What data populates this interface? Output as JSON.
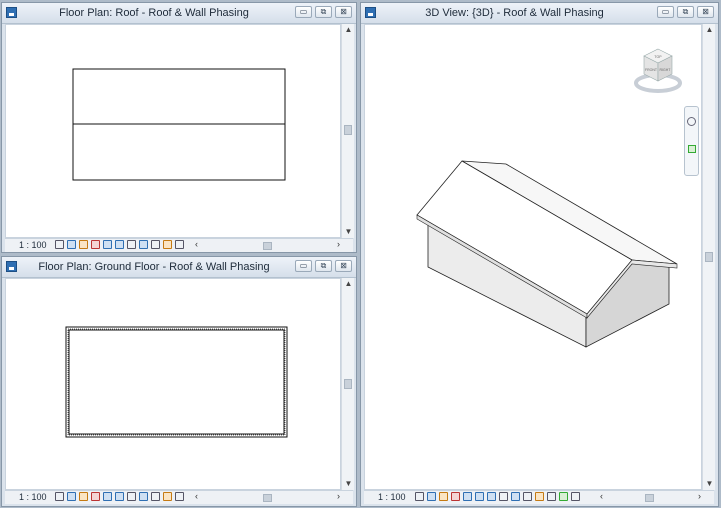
{
  "windows": {
    "roof_plan": {
      "title": "Floor Plan: Roof - Roof & Wall Phasing",
      "scale": "1 : 100"
    },
    "ground_plan": {
      "title": "Floor Plan: Ground Floor - Roof & Wall Phasing",
      "scale": "1 : 100"
    },
    "view3d": {
      "title": "3D View: {3D} - Roof & Wall Phasing",
      "scale": "1 : 100"
    }
  },
  "viewcube": {
    "top_label": "TOP",
    "front_label": "FRONT",
    "right_label": "RIGHT"
  },
  "controls": {
    "minimize": "▭",
    "restore": "⧉",
    "close": "⊠"
  },
  "glyphs": {
    "scroll_up": "▲",
    "scroll_down": "▼",
    "scroll_left": "‹",
    "scroll_right": "›",
    "grip": "⁞"
  },
  "icons": {
    "window": "revit-view-icon",
    "view_controls": [
      "detail-level-icon",
      "visual-style-icon",
      "sun-path-icon",
      "shadows-icon",
      "crop-view-icon",
      "show-crop-icon",
      "unlock-3d-icon",
      "temporary-hide-icon",
      "reveal-hidden-icon",
      "analytical-icon"
    ]
  },
  "colors": {
    "frame": "#8797a8",
    "canvas": "#ffffff",
    "wall_shade": "#e8e8e8",
    "accent": "#2f6fb3"
  }
}
